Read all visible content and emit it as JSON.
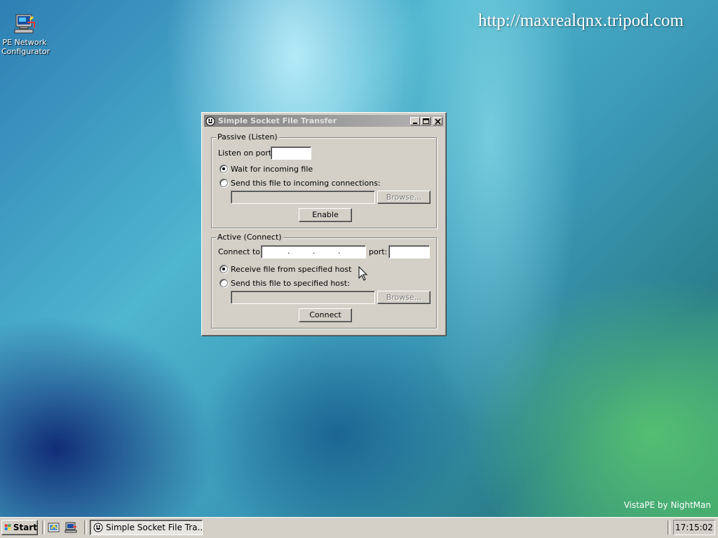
{
  "desktop": {
    "icon_label": "PE Network Configurator",
    "url_text": "http://maxrealqnx.tripod.com",
    "brand_text": "VistaPE by NightMan"
  },
  "window": {
    "title": "Simple Socket File Transfer",
    "passive": {
      "group_label": "Passive (Listen)",
      "port_label": "Listen on port:",
      "port_value": "",
      "option_wait": "Wait for incoming file",
      "option_send": "Send this file to incoming connections:",
      "selected": "wait",
      "file_value": "",
      "browse_label": "Browse...",
      "enable_label": "Enable"
    },
    "active": {
      "group_label": "Active (Connect)",
      "connect_label": "Connect to:",
      "ip_value": "",
      "port_label": "port:",
      "port_value": "",
      "option_receive": "Receive file from specified host",
      "option_send": "Send this file to specified host:",
      "selected": "receive",
      "file_value": "",
      "browse_label": "Browse...",
      "connect_button": "Connect"
    }
  },
  "taskbar": {
    "start_label": "Start",
    "task_label": "Simple Socket File Tra...",
    "clock": "17:15:02"
  },
  "colors": {
    "window_face": "#d4d0c8",
    "titlebar_inactive": "#808080",
    "desktop_blue": "#2e7fb4"
  }
}
